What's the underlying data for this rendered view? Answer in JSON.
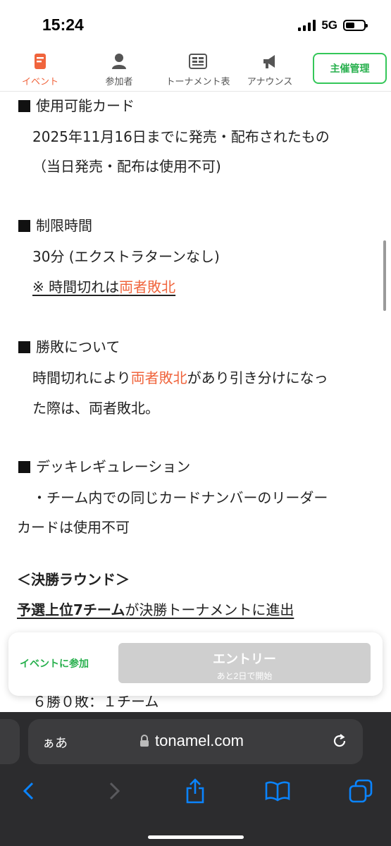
{
  "status_bar": {
    "time": "15:24",
    "network": "5G",
    "battery_level": 0.5
  },
  "nav": {
    "tabs": [
      {
        "label": "イベント",
        "icon": "document-icon",
        "active": true
      },
      {
        "label": "参加者",
        "icon": "person-icon",
        "active": false
      },
      {
        "label": "トーナメント表",
        "icon": "bracket-icon",
        "active": false
      },
      {
        "label": "アナウンス",
        "icon": "megaphone-icon",
        "active": false
      }
    ],
    "host_button": "主催管理"
  },
  "content": {
    "usable_cards": {
      "heading": "使用可能カード",
      "line1": "2025年11月16日までに発売・配布されたもの",
      "line2": "（当日発売・配布は使用不可)"
    },
    "time_limit": {
      "heading": "制限時間",
      "line1": "30分 (エクストラターンなし)",
      "note_prefix": "※ 時間切れは",
      "note_highlight": "両者敗北"
    },
    "win_loss": {
      "heading": "勝敗について",
      "line1_prefix": "時間切れにより",
      "line1_highlight": "両者敗北",
      "line1_suffix": "があり引き分けになっ",
      "line2": "た際は、両者敗北。"
    },
    "deck_regulation": {
      "heading": "デッキレギュレーション",
      "line1": "・チーム内での同じカードナンバーのリーダー",
      "line2": "カードは使用不可"
    },
    "finals": {
      "heading": "＜決勝ラウンド＞",
      "line1_bold": "予選上位7チーム",
      "line1_rest": "が決勝トーナメントに進出",
      "partial_line": "６勝０敗：１チーム"
    }
  },
  "entry": {
    "join_label": "イベントに参加",
    "button_label": "エントリー",
    "button_sub": "あと2日で開始"
  },
  "safari": {
    "aa_label": "ぁあ",
    "url": "tonamel.com",
    "icons": [
      "back-icon",
      "forward-icon",
      "share-icon",
      "bookmarks-icon",
      "tabs-icon"
    ]
  },
  "colors": {
    "accent_orange": "#f0643c",
    "accent_green": "#34c759",
    "safari_blue": "#0a84ff"
  }
}
